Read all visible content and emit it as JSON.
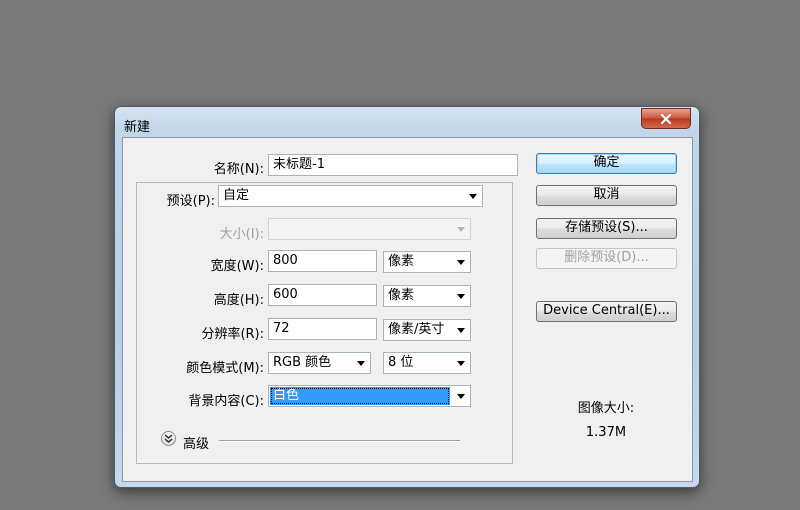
{
  "dialog": {
    "title": "新建",
    "close_glyph": "x"
  },
  "form": {
    "name_label": "名称(N):",
    "name_value": "未标题-1",
    "preset_label": "预设(P):",
    "preset_value": "自定",
    "size_label": "大小(I):",
    "size_value": "",
    "width_label": "宽度(W):",
    "width_value": "800",
    "width_unit": "像素",
    "height_label": "高度(H):",
    "height_value": "600",
    "height_unit": "像素",
    "resolution_label": "分辨率(R):",
    "resolution_value": "72",
    "resolution_unit": "像素/英寸",
    "color_mode_label": "颜色模式(M):",
    "color_mode_value": "RGB 颜色",
    "bit_depth_value": "8 位",
    "background_label": "背景内容(C):",
    "background_value": "白色",
    "advanced_label": "高级"
  },
  "buttons": {
    "ok": "确定",
    "cancel": "取消",
    "save_preset": "存储预设(S)...",
    "delete_preset": "删除预设(D)...",
    "device_central": "Device Central(E)..."
  },
  "image_size": {
    "label": "图像大小:",
    "value": "1.37M"
  },
  "colors": {
    "desktop": "#7a7a7a",
    "selection": "#3399ff",
    "default_button_border": "#3c7fb1",
    "close_button": "#c9553c"
  }
}
